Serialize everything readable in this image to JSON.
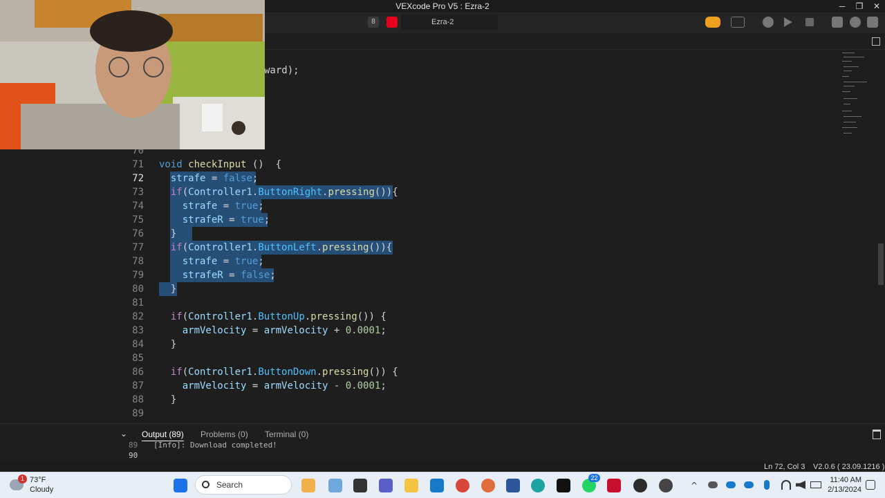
{
  "window": {
    "title": "VEXcode Pro V5 : Ezra-2",
    "tab": "Ezra-2",
    "tab_badge": "8"
  },
  "editor": {
    "partial_top_line": "ward);",
    "lines": [
      {
        "n": "70"
      },
      {
        "n": "71"
      },
      {
        "n": "72"
      },
      {
        "n": "73"
      },
      {
        "n": "74"
      },
      {
        "n": "75"
      },
      {
        "n": "76"
      },
      {
        "n": "77"
      },
      {
        "n": "78"
      },
      {
        "n": "79"
      },
      {
        "n": "80"
      },
      {
        "n": "81"
      },
      {
        "n": "82"
      },
      {
        "n": "83"
      },
      {
        "n": "84"
      },
      {
        "n": "85"
      },
      {
        "n": "86"
      },
      {
        "n": "87"
      },
      {
        "n": "88"
      },
      {
        "n": "89"
      }
    ]
  },
  "panel": {
    "tab_output": "Output (89)",
    "tab_problems": "Problems (0)",
    "tab_terminal": "Terminal (0)",
    "output_line_89": "89",
    "output_line_90": "90",
    "output_text": "[Info]: Download completed!"
  },
  "status": {
    "cursor": "Ln 72, Col 3",
    "version": "V2.0.6 ( 23.09.1216 )"
  },
  "taskbar": {
    "weather_temp": "73°F",
    "weather_desc": "Cloudy",
    "weather_badge": "1",
    "search": "Search",
    "time": "11:40 AM",
    "date": "2/13/2024",
    "notif_badge": "22"
  },
  "colors": {
    "accent": "#e8001c",
    "selection": "#264f78",
    "brand_orange": "#f0a020"
  }
}
